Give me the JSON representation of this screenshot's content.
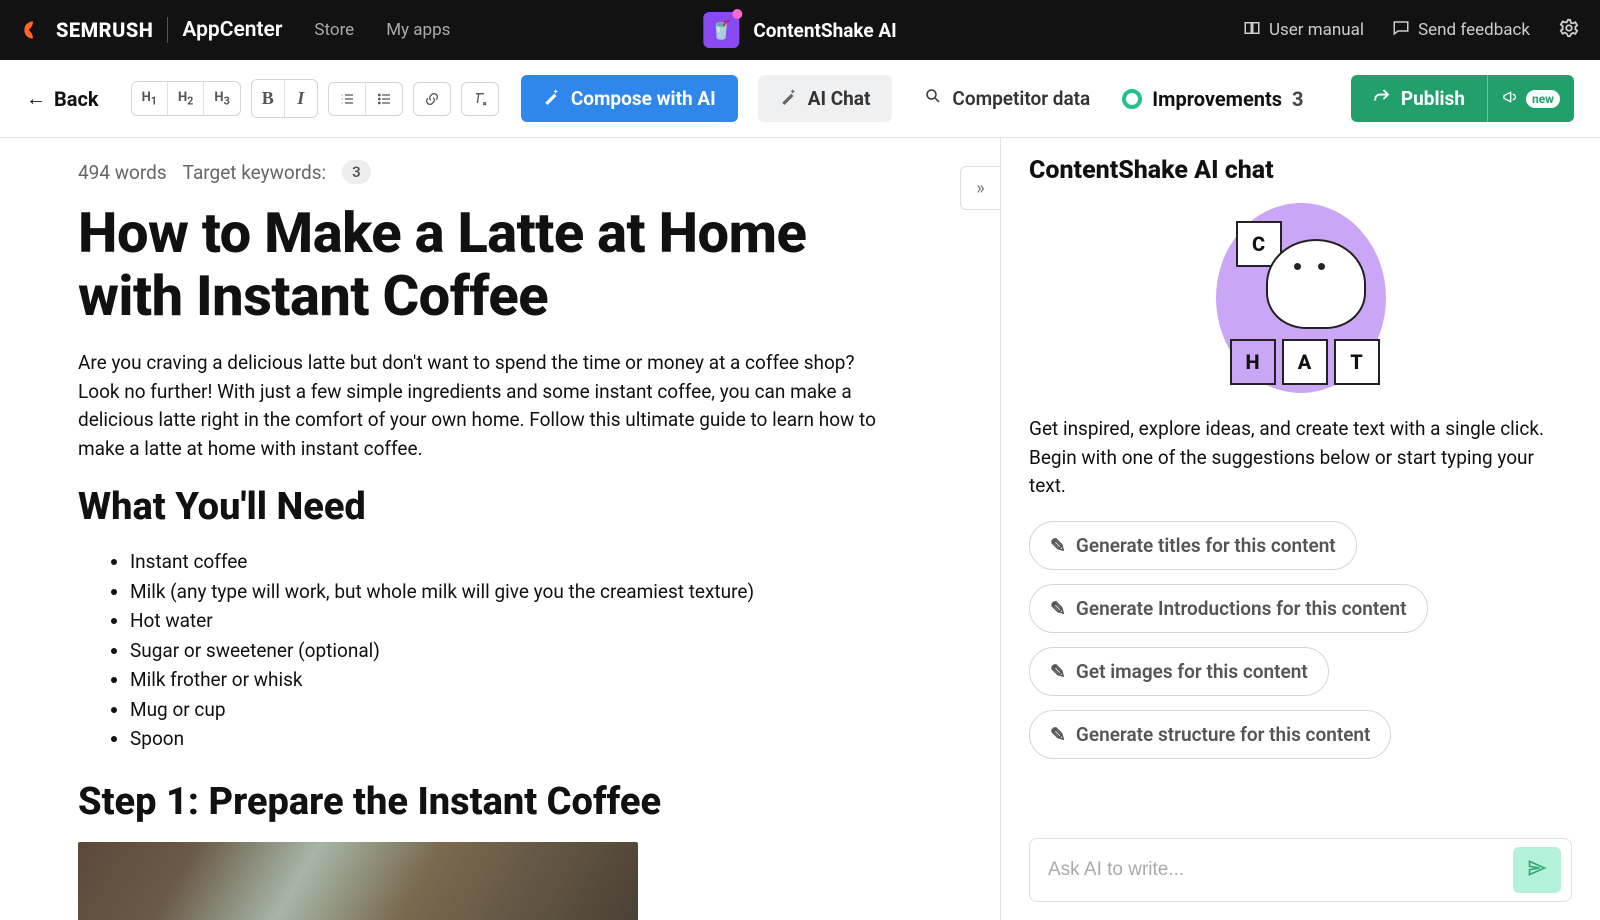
{
  "topbar": {
    "brand": "SEMRUSH",
    "appcenter": "AppCenter",
    "store": "Store",
    "myapps": "My apps",
    "app_name": "ContentShake AI",
    "user_manual": "User manual",
    "send_feedback": "Send feedback"
  },
  "toolbar": {
    "back": "Back",
    "h1": "H1",
    "h2": "H2",
    "h3": "H3",
    "bold": "B",
    "italic": "I",
    "compose": "Compose with AI",
    "ai_chat": "AI Chat",
    "competitor": "Competitor data",
    "improvements_label": "Improvements",
    "improvements_count": "3",
    "publish": "Publish",
    "new_badge": "new"
  },
  "meta": {
    "words": "494 words",
    "keywords_label": "Target keywords:",
    "keywords_count": "3"
  },
  "doc": {
    "title": "How to Make a Latte at Home with Instant Coffee",
    "intro": "Are you craving a delicious latte but don't want to spend the time or money at a coffee shop? Look no further! With just a few simple ingredients and some instant coffee, you can make a delicious latte right in the comfort of your own home. Follow this ultimate guide to learn how to make a latte at home with instant coffee.",
    "h2a": "What You'll Need",
    "items": [
      "Instant coffee",
      "Milk (any type will work, but whole milk will give you the creamiest texture)",
      "Hot water",
      "Sugar or sweetener (optional)",
      "Milk frother or whisk",
      "Mug or cup",
      "Spoon"
    ],
    "h2b": "Step 1: Prepare the Instant Coffee"
  },
  "chat": {
    "title": "ContentShake AI chat",
    "intro": "Get inspired, explore ideas, and create text with a single click. Begin with one of the suggestions below or start typing your text.",
    "suggestions": [
      "Generate titles for this content",
      "Generate Introductions for this content",
      "Get images for this content",
      "Generate structure for this content"
    ],
    "placeholder": "Ask AI to write..."
  }
}
